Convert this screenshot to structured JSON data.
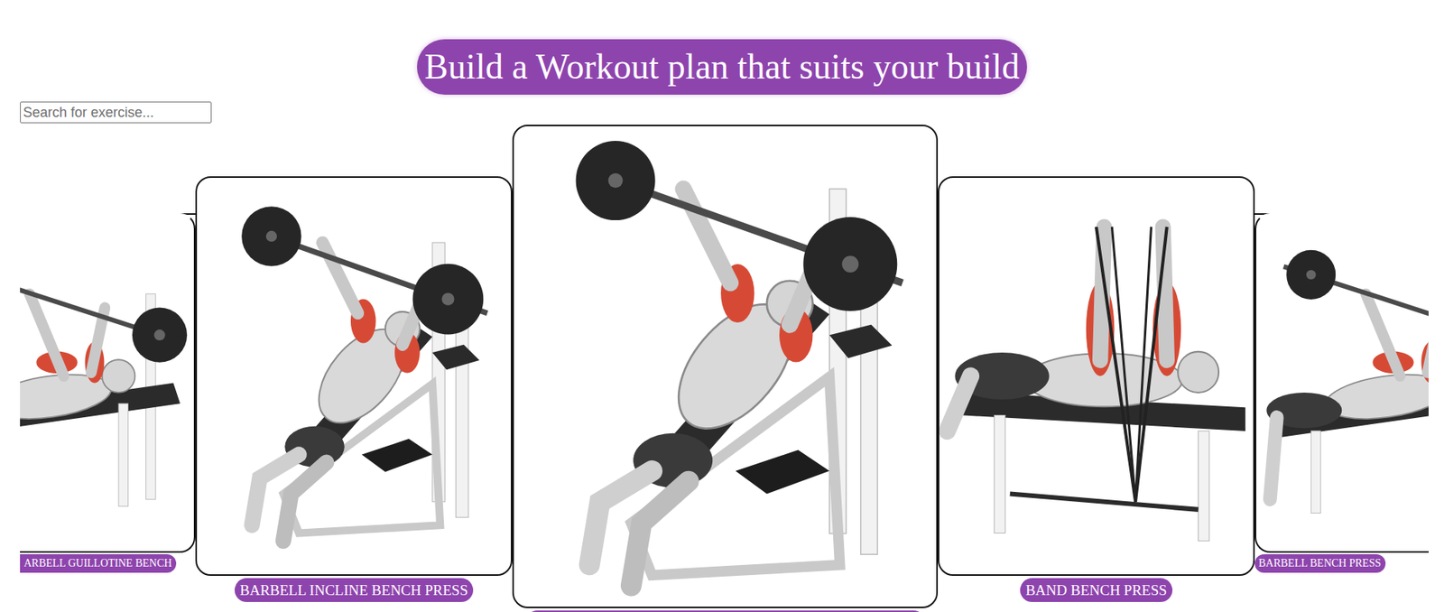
{
  "title": "Build a Workout plan that suits your build",
  "search": {
    "placeholder": "Search for exercise..."
  },
  "exercises": [
    {
      "label": "ARBELL GUILLOTINE BENCH",
      "kind": "flat",
      "selected": false
    },
    {
      "label": "BARBELL INCLINE BENCH PRESS",
      "kind": "incline",
      "selected": false
    },
    {
      "label": "",
      "kind": "incline",
      "selected": true
    },
    {
      "label": "BAND BENCH PRESS",
      "kind": "band",
      "selected": false
    },
    {
      "label": "BARBELL BENCH PRESS",
      "kind": "flat",
      "selected": false
    }
  ]
}
